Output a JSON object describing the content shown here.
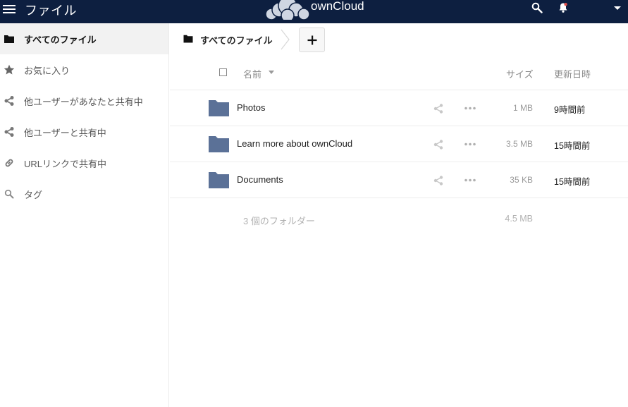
{
  "header": {
    "app_title": "ファイル",
    "brand": "ownCloud",
    "icons": [
      "menu-icon",
      "owncloud-logo",
      "search-icon",
      "bell-icon",
      "chevron-down-icon"
    ],
    "colors": {
      "bar": "#0d1f40",
      "folder": "#5b7197"
    }
  },
  "sidebar": {
    "items": [
      {
        "label": "すべてのファイル",
        "icon": "folder-icon",
        "active": true
      },
      {
        "label": "お気に入り",
        "icon": "star-icon",
        "active": false
      },
      {
        "label": "他ユーザーがあなたと共有中",
        "icon": "share-icon",
        "active": false
      },
      {
        "label": "他ユーザーと共有中",
        "icon": "share-icon",
        "active": false
      },
      {
        "label": "URLリンクで共有中",
        "icon": "link-icon",
        "active": false
      },
      {
        "label": "タグ",
        "icon": "tag-search-icon",
        "active": false
      }
    ]
  },
  "breadcrumb": {
    "home_label": "すべてのファイル",
    "new_button": "+"
  },
  "table": {
    "columns": {
      "name": "名前",
      "size": "サイズ",
      "modified": "更新日時"
    },
    "rows": [
      {
        "name": "Photos",
        "size": "1 MB",
        "modified": "9時間前"
      },
      {
        "name": "Learn more about ownCloud",
        "size": "3.5 MB",
        "modified": "15時間前"
      },
      {
        "name": "Documents",
        "size": "35 KB",
        "modified": "15時間前"
      }
    ],
    "summary": {
      "text": "3 個のフォルダー",
      "size": "4.5 MB"
    }
  }
}
